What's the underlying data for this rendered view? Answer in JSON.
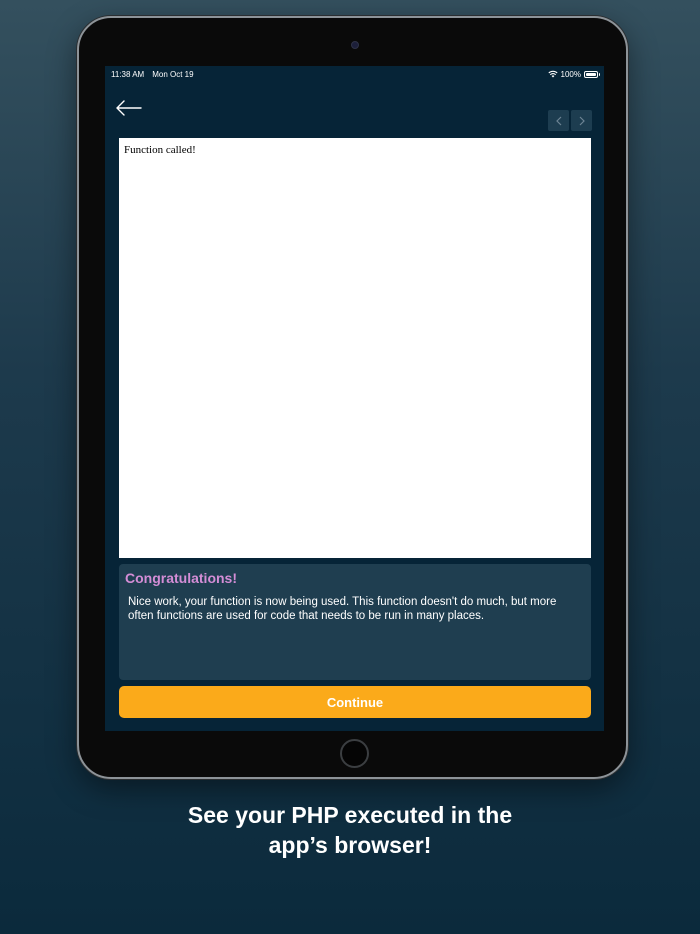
{
  "status_bar": {
    "time": "11:38 AM",
    "date": "Mon Oct 19",
    "battery": "100%"
  },
  "browser": {
    "output_text": "Function called!"
  },
  "message": {
    "title": "Congratulations!",
    "body": "Nice work, your function is now being used. This function doesn't do much, but more often functions are used for code that needs to be run in many places."
  },
  "actions": {
    "continue_label": "Continue"
  },
  "caption": {
    "line1": "See your PHP executed in the",
    "line2": "app’s browser!"
  },
  "colors": {
    "accent": "#fbaa1a",
    "title_purple": "#d48dd6",
    "screen_bg": "#062437",
    "card_bg": "#1f3e50"
  }
}
